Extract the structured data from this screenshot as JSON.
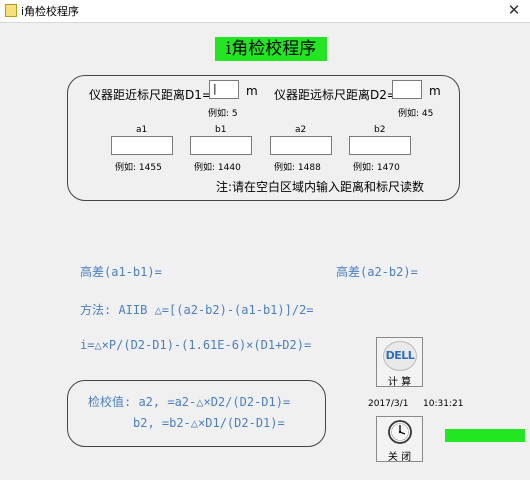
{
  "window": {
    "title": "i角检校程序",
    "close_glyph": "✕"
  },
  "app_title": "i角检校程序",
  "inputs": {
    "d1_label": "仪器距近标尺距离D1=",
    "d1_unit": "m",
    "d1_value": "|",
    "d1_example": "例如: 5",
    "d2_label": "仪器距远标尺距离D2=",
    "d2_unit": "m",
    "d2_value": "",
    "d2_example": "例如: 45",
    "readings": [
      {
        "label": "a1",
        "value": "",
        "example": "例如: 1455"
      },
      {
        "label": "b1",
        "value": "",
        "example": "例如: 1440"
      },
      {
        "label": "a2",
        "value": "",
        "example": "例如: 1488"
      },
      {
        "label": "b2",
        "value": "",
        "example": "例如: 1470"
      }
    ],
    "note": "注:请在空白区域内输入距离和标尺读数"
  },
  "results": {
    "h1": "高差(a1-b1)=",
    "h2": "高差(a2-b2)=",
    "method": "方法: AIIB   △=[(a2-b2)-(a1-b1)]/2=",
    "i_formula": "i=△×P/(D2-D1)-(1.61E-6)×(D1+D2)="
  },
  "check": {
    "line1": "检校值: a2, =a2-△×D2/(D2-D1)=",
    "line2": "b2, =b2-△×D1/(D2-D1)="
  },
  "buttons": {
    "calc_logo": "DELL",
    "calc_label": "计 算",
    "close_label": "关 闭"
  },
  "status": {
    "date": "2017/3/1",
    "time": "10:31:21"
  },
  "colors": {
    "accent_green": "#22e622",
    "result_blue": "#4a7fc4"
  },
  "icons": {
    "calc": "dell-logo-icon",
    "close": "clock-icon",
    "app": "app-icon"
  }
}
